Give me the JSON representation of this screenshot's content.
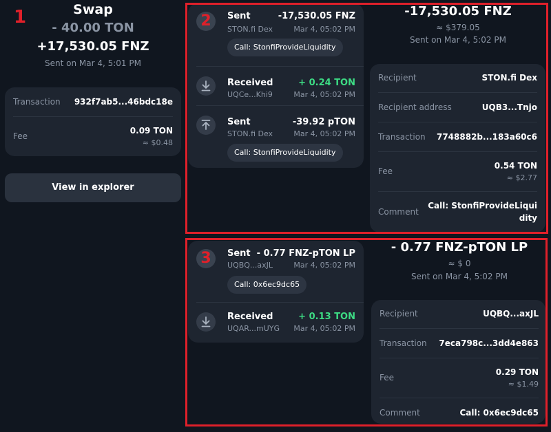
{
  "annotations": {
    "label_1": "1",
    "label_2": "2",
    "label_3": "3"
  },
  "summary": {
    "title": "Swap",
    "sent_amount": "- 40.00 TON",
    "received_amount": "+17,530.05 FNZ",
    "subtitle": "Sent on Mar 4, 5:01 PM",
    "details": {
      "transaction_label": "Transaction",
      "transaction_value": "932f7ab5...46bdc18e",
      "fee_label": "Fee",
      "fee_value": "0.09 TON",
      "fee_fiat": "≈ $0.48"
    },
    "explorer_button": "View in explorer"
  },
  "group2": {
    "items": [
      {
        "title": "Sent",
        "amount": "-17,530.05 FNZ",
        "party": "STON.fi Dex",
        "time": "Mar 4, 05:02 PM",
        "chip": "Call: StonfiProvideLiquidity"
      },
      {
        "title": "Received",
        "amount": "+ 0.24 TON",
        "party": "UQCe...Khi9",
        "time": "Mar 4, 05:02 PM"
      },
      {
        "title": "Sent",
        "amount": "-39.92 pTON",
        "party": "STON.fi Dex",
        "time": "Mar 4, 05:02 PM",
        "chip": "Call: StonfiProvideLiquidity"
      }
    ],
    "detail": {
      "amount": "-17,530.05 FNZ",
      "fiat": "≈ $379.05",
      "subtitle": "Sent on Mar 4, 5:02 PM",
      "recipient_label": "Recipient",
      "recipient_value": "STON.fi Dex",
      "address_label": "Recipient address",
      "address_value": "UQB3...Tnjo",
      "transaction_label": "Transaction",
      "transaction_value": "7748882b...183a60c6",
      "fee_label": "Fee",
      "fee_value": "0.54 TON",
      "fee_fiat": "≈ $2.77",
      "comment_label": "Comment",
      "comment_line1": "Call: StonfiProvideLiqui",
      "comment_line2": "dity"
    }
  },
  "group3": {
    "items": [
      {
        "title": "Sent",
        "amount": "- 0.77 FNZ-pTON LP",
        "party": "UQBQ...axJL",
        "time": "Mar 4, 05:02 PM",
        "chip": "Call: 0x6ec9dc65"
      },
      {
        "title": "Received",
        "amount": "+ 0.13 TON",
        "party": "UQAR...mUYG",
        "time": "Mar 4, 05:02 PM"
      }
    ],
    "detail": {
      "amount": "- 0.77 FNZ-pTON LP",
      "fiat": "≈ $ 0",
      "subtitle": "Sent on Mar 4, 5:02 PM",
      "recipient_label": "Recipient",
      "recipient_value": "UQBQ...axJL",
      "transaction_label": "Transaction",
      "transaction_value": "7eca798c...3dd4e863",
      "fee_label": "Fee",
      "fee_value": "0.29 TON",
      "fee_fiat": "≈ $1.49",
      "comment_label": "Comment",
      "comment_value": "Call: 0x6ec9dc65"
    }
  }
}
